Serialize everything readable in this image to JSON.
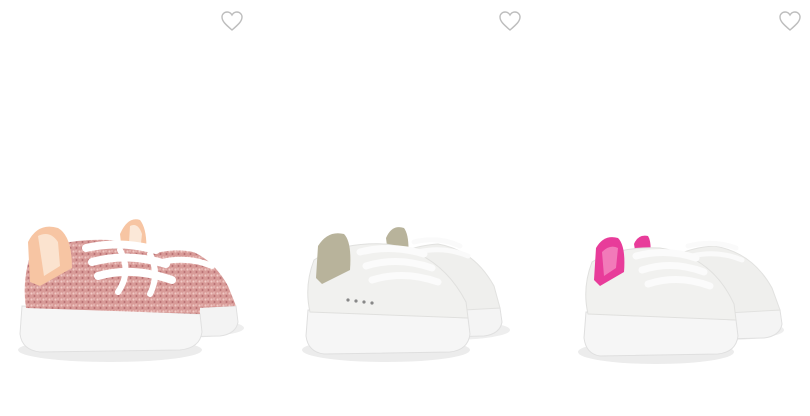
{
  "products": [
    {
      "image_description_icon": "glitter-sneaker",
      "wishlist_icon": "heart-outline-icon",
      "colors": {
        "upper": "#d79a98",
        "heel": "#f7c5a3",
        "sole": "#f4f4f4"
      }
    },
    {
      "image_description_icon": "white-sneaker",
      "wishlist_icon": "heart-outline-icon",
      "colors": {
        "upper": "#f0f0ee",
        "heel": "#b8b39b",
        "sole": "#f4f4f4"
      }
    },
    {
      "image_description_icon": "white-sneaker",
      "wishlist_icon": "heart-outline-icon",
      "colors": {
        "upper": "#f0f0ee",
        "heel": "#e83c9a",
        "sole": "#f4f4f4"
      }
    }
  ]
}
